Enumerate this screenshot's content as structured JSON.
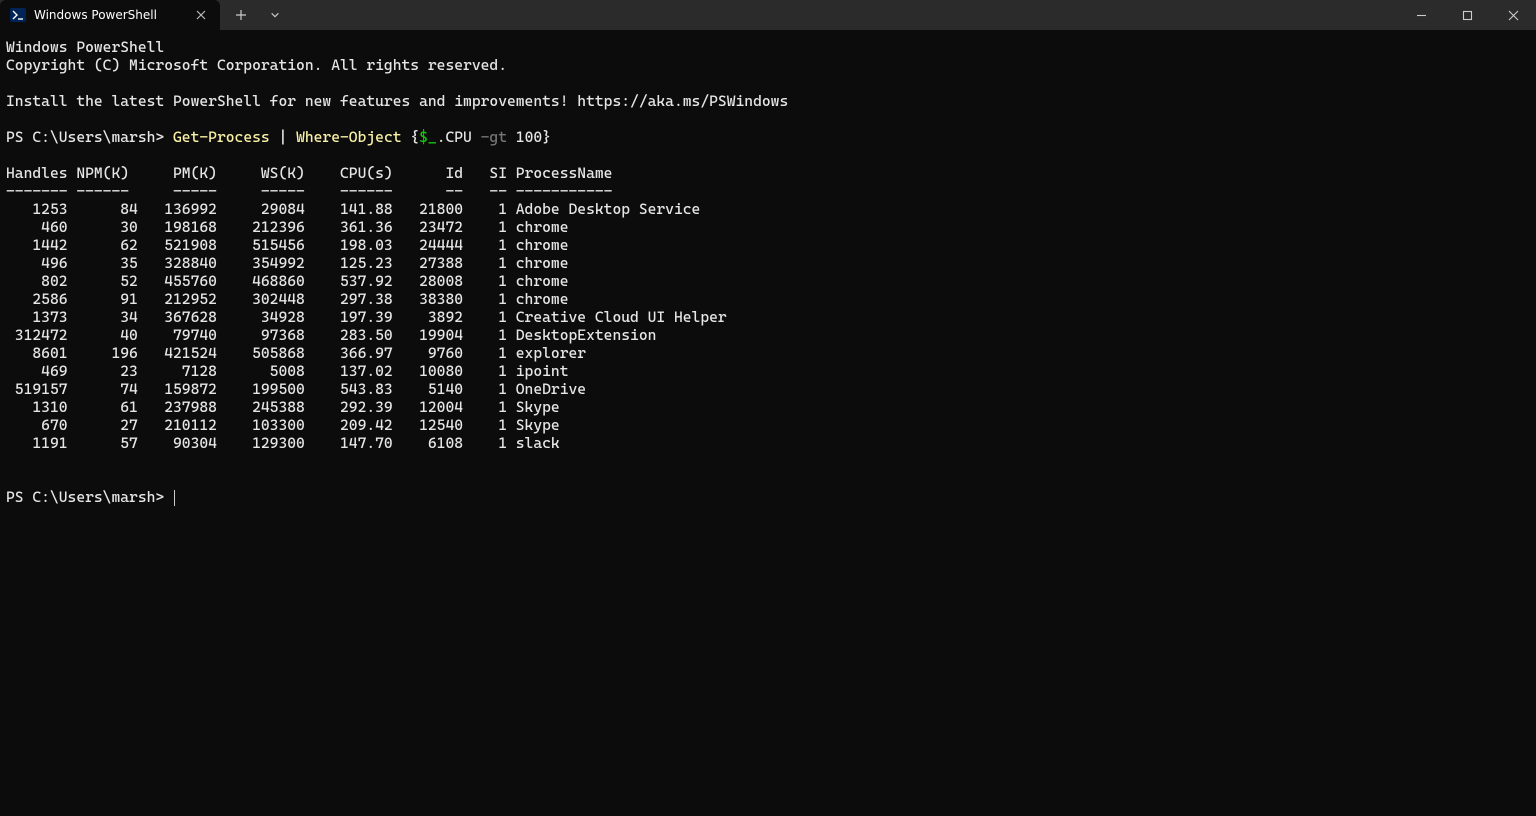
{
  "titlebar": {
    "tab_title": "Windows PowerShell",
    "new_tab_label": "+",
    "dropdown_label": "⌄",
    "min_label": "—",
    "max_label": "▢",
    "close_label": "✕"
  },
  "terminal": {
    "header1": "Windows PowerShell",
    "header2": "Copyright (C) Microsoft Corporation. All rights reserved.",
    "install": "Install the latest PowerShell for new features and improvements! https://aka.ms/PSWindows",
    "prompt1": "PS C:\\Users\\marsh> ",
    "command": {
      "cmdlet1": "Get-Process",
      "pipe": " | ",
      "cmdlet2": "Where-Object",
      "brace_open": " {",
      "dollar": "$_",
      "prop": ".CPU ",
      "op": "-gt",
      "num": " 100",
      "brace_close": "}"
    },
    "columns": [
      "Handles",
      "NPM(K)",
      "PM(K)",
      "WS(K)",
      "CPU(s)",
      "Id",
      "SI",
      "ProcessName"
    ],
    "underlines": [
      "-------",
      "------",
      "-----",
      "-----",
      "------",
      "--",
      "--",
      "-----------"
    ],
    "rows": [
      {
        "handles": "1253",
        "npm": "84",
        "pm": "136992",
        "ws": "29084",
        "cpu": "141.88",
        "id": "21800",
        "si": "1",
        "name": "Adobe Desktop Service"
      },
      {
        "handles": "460",
        "npm": "30",
        "pm": "198168",
        "ws": "212396",
        "cpu": "361.36",
        "id": "23472",
        "si": "1",
        "name": "chrome"
      },
      {
        "handles": "1442",
        "npm": "62",
        "pm": "521908",
        "ws": "515456",
        "cpu": "198.03",
        "id": "24444",
        "si": "1",
        "name": "chrome"
      },
      {
        "handles": "496",
        "npm": "35",
        "pm": "328840",
        "ws": "354992",
        "cpu": "125.23",
        "id": "27388",
        "si": "1",
        "name": "chrome"
      },
      {
        "handles": "802",
        "npm": "52",
        "pm": "455760",
        "ws": "468860",
        "cpu": "537.92",
        "id": "28008",
        "si": "1",
        "name": "chrome"
      },
      {
        "handles": "2586",
        "npm": "91",
        "pm": "212952",
        "ws": "302448",
        "cpu": "297.38",
        "id": "38380",
        "si": "1",
        "name": "chrome"
      },
      {
        "handles": "1373",
        "npm": "34",
        "pm": "367628",
        "ws": "34928",
        "cpu": "197.39",
        "id": "3892",
        "si": "1",
        "name": "Creative Cloud UI Helper"
      },
      {
        "handles": "312472",
        "npm": "40",
        "pm": "79740",
        "ws": "97368",
        "cpu": "283.50",
        "id": "19904",
        "si": "1",
        "name": "DesktopExtension"
      },
      {
        "handles": "8601",
        "npm": "196",
        "pm": "421524",
        "ws": "505868",
        "cpu": "366.97",
        "id": "9760",
        "si": "1",
        "name": "explorer"
      },
      {
        "handles": "469",
        "npm": "23",
        "pm": "7128",
        "ws": "5008",
        "cpu": "137.02",
        "id": "10080",
        "si": "1",
        "name": "ipoint"
      },
      {
        "handles": "519157",
        "npm": "74",
        "pm": "159872",
        "ws": "199500",
        "cpu": "543.83",
        "id": "5140",
        "si": "1",
        "name": "OneDrive"
      },
      {
        "handles": "1310",
        "npm": "61",
        "pm": "237988",
        "ws": "245388",
        "cpu": "292.39",
        "id": "12004",
        "si": "1",
        "name": "Skype"
      },
      {
        "handles": "670",
        "npm": "27",
        "pm": "210112",
        "ws": "103300",
        "cpu": "209.42",
        "id": "12540",
        "si": "1",
        "name": "Skype"
      },
      {
        "handles": "1191",
        "npm": "57",
        "pm": "90304",
        "ws": "129300",
        "cpu": "147.70",
        "id": "6108",
        "si": "1",
        "name": "slack"
      }
    ],
    "prompt2": "PS C:\\Users\\marsh> "
  }
}
